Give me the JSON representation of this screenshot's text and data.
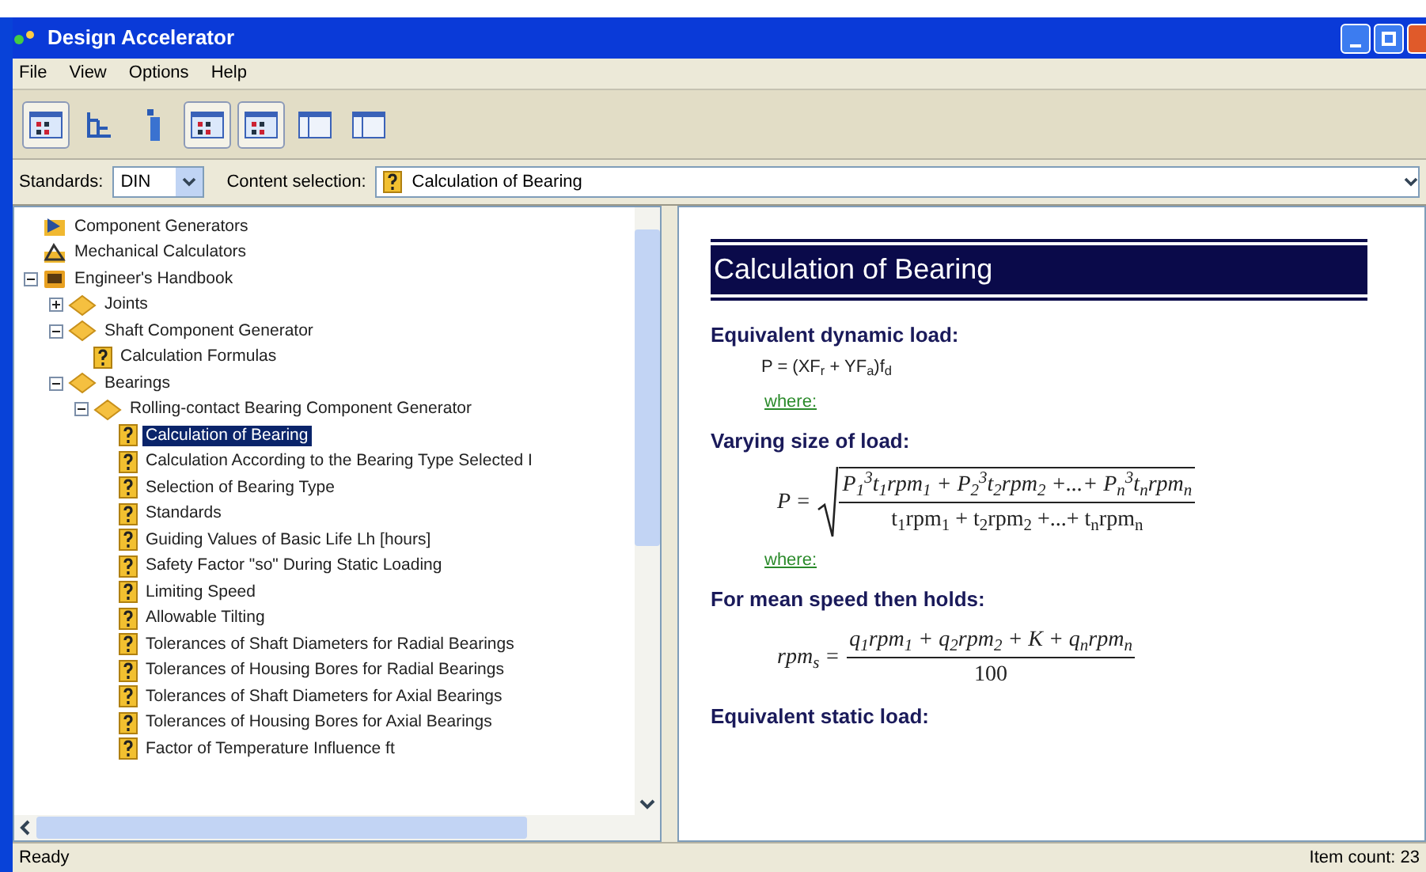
{
  "window": {
    "title": "Design Accelerator"
  },
  "menu": [
    "File",
    "View",
    "Options",
    "Help"
  ],
  "toolbar": [
    {
      "kind": "grid",
      "pressed": true
    },
    {
      "kind": "tree",
      "pressed": false
    },
    {
      "kind": "bar",
      "pressed": false
    },
    {
      "kind": "grid",
      "pressed": true
    },
    {
      "kind": "grid",
      "pressed": true
    },
    {
      "kind": "panel",
      "pressed": false
    },
    {
      "kind": "panel",
      "pressed": false
    }
  ],
  "standards": {
    "label": "Standards:",
    "value": "DIN"
  },
  "content_selection": {
    "label": "Content selection:",
    "value": "Calculation of Bearing"
  },
  "tree": [
    {
      "label": "Component Generators",
      "kind": "generator",
      "selected": false
    },
    {
      "label": "Mechanical Calculators",
      "kind": "calculator",
      "selected": false
    },
    {
      "label": "Engineer's Handbook",
      "kind": "book",
      "selected": false,
      "expanded": true,
      "children": [
        {
          "label": "Joints",
          "kind": "folder",
          "selected": false,
          "expanded": false
        },
        {
          "label": "Shaft Component Generator",
          "kind": "folder",
          "selected": false,
          "expanded": true,
          "children": [
            {
              "label": "Calculation Formulas",
              "kind": "page",
              "selected": false
            }
          ]
        },
        {
          "label": "Bearings",
          "kind": "folder",
          "selected": false,
          "expanded": true,
          "children": [
            {
              "label": "Rolling-contact Bearing Component Generator",
              "kind": "folder",
              "selected": false,
              "expanded": true,
              "children": [
                {
                  "label": "Calculation of Bearing",
                  "kind": "page",
                  "selected": true
                },
                {
                  "label": "Calculation According to the Bearing Type Selected I",
                  "kind": "page",
                  "selected": false
                },
                {
                  "label": "Selection of Bearing Type",
                  "kind": "page",
                  "selected": false
                },
                {
                  "label": "Standards",
                  "kind": "page",
                  "selected": false
                },
                {
                  "label": "Guiding Values of Basic Life Lh [hours]",
                  "kind": "page",
                  "selected": false
                },
                {
                  "label": "Safety Factor \"so\" During Static Loading",
                  "kind": "page",
                  "selected": false
                },
                {
                  "label": "Limiting Speed",
                  "kind": "page",
                  "selected": false
                },
                {
                  "label": "Allowable Tilting",
                  "kind": "page",
                  "selected": false
                },
                {
                  "label": "Tolerances of Shaft Diameters for Radial Bearings",
                  "kind": "page",
                  "selected": false
                },
                {
                  "label": "Tolerances of Housing Bores for Radial Bearings",
                  "kind": "page",
                  "selected": false
                },
                {
                  "label": "Tolerances of Shaft Diameters for Axial Bearings",
                  "kind": "page",
                  "selected": false
                },
                {
                  "label": "Tolerances of Housing Bores for Axial Bearings",
                  "kind": "page",
                  "selected": false
                },
                {
                  "label": "Factor of Temperature Influence ft",
                  "kind": "page",
                  "selected": false
                }
              ]
            }
          ]
        }
      ]
    }
  ],
  "document": {
    "title": "Calculation of Bearing",
    "blocks": [
      {
        "kind": "heading",
        "text": "Equivalent dynamic load:"
      },
      {
        "kind": "formula",
        "text": "P = (XF$_{r}$ + YF$_{a}$)f$_{d}$"
      },
      {
        "kind": "link",
        "text": "where:"
      },
      {
        "kind": "heading",
        "text": "Varying size of load:"
      },
      {
        "kind": "root_fraction",
        "lhs": "P =",
        "numerator": "P$_{1}$$^{3}$t$_{1}$rpm$_{1}$ + P$_{2}$$^{3}$t$_{2}$rpm$_{2}$ +...+ P$_{n}$$^{3}$t$_{n}$rpm$_{n}$",
        "denominator": "t$_{1}$rpm$_{1}$ + t$_{2}$rpm$_{2}$ +...+ t$_{n}$rpm$_{n}$"
      },
      {
        "kind": "link",
        "text": "where:"
      },
      {
        "kind": "heading",
        "text": "For mean speed then holds:"
      },
      {
        "kind": "fraction",
        "lhs": "rpm$_{s}$ =",
        "numerator": "q$_{1}$rpm$_{1}$ + q$_{2}$rpm$_{2}$ + K + q$_{n}$rpm$_{n}$",
        "denominator": "100"
      },
      {
        "kind": "heading",
        "text": "Equivalent static load:"
      }
    ]
  },
  "status_bar": {
    "left": "Ready",
    "right": "Item count: 23"
  }
}
